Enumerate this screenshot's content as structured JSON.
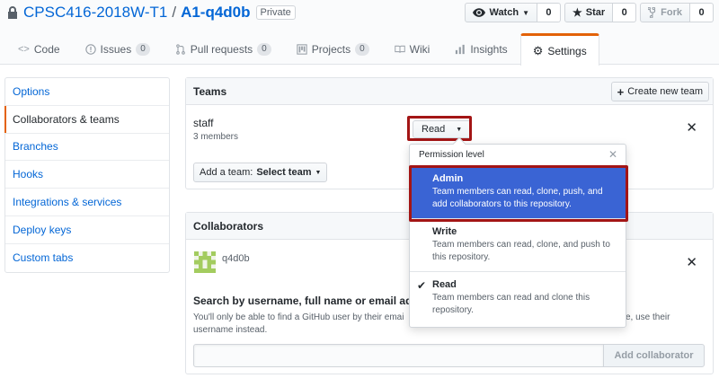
{
  "repo": {
    "owner": "CPSC416-2018W-T1",
    "separator": "/",
    "name": "A1-q4d0b",
    "visibility": "Private"
  },
  "actions": {
    "watch": {
      "label": "Watch",
      "count": "0"
    },
    "star": {
      "label": "Star",
      "count": "0"
    },
    "fork": {
      "label": "Fork",
      "count": "0"
    }
  },
  "tabs": [
    {
      "label": "Code",
      "count": null
    },
    {
      "label": "Issues",
      "count": "0"
    },
    {
      "label": "Pull requests",
      "count": "0"
    },
    {
      "label": "Projects",
      "count": "0"
    },
    {
      "label": "Wiki",
      "count": null
    },
    {
      "label": "Insights",
      "count": null
    },
    {
      "label": "Settings",
      "count": null
    }
  ],
  "sidebar": {
    "items": [
      {
        "label": "Options"
      },
      {
        "label": "Collaborators & teams"
      },
      {
        "label": "Branches"
      },
      {
        "label": "Hooks"
      },
      {
        "label": "Integrations & services"
      },
      {
        "label": "Deploy keys"
      },
      {
        "label": "Custom tabs"
      }
    ],
    "selected_index": 1
  },
  "teams": {
    "header": "Teams",
    "create_button": "Create new team",
    "team": {
      "name": "staff",
      "members": "3 members",
      "permission": "Read"
    },
    "add_team_prefix": "Add a team:",
    "add_team_select": "Select team"
  },
  "permission_dropdown": {
    "header": "Permission level",
    "options": [
      {
        "title": "Admin",
        "description": "Team members can read, clone, push, and add collaborators to this repository.",
        "active": true,
        "checked": false
      },
      {
        "title": "Write",
        "description": "Team members can read, clone, and push to this repository.",
        "active": false,
        "checked": false
      },
      {
        "title": "Read",
        "description": "Team members can read and clone this repository.",
        "active": false,
        "checked": true
      }
    ]
  },
  "collaborators": {
    "header": "Collaborators",
    "user": "q4d0b",
    "search_title": "Search by username, full name or email addr",
    "search_help_left": "You'll only be able to find a GitHub user by their emai",
    "search_help_right": "e, use their",
    "search_help_line2": "username instead.",
    "add_button": "Add collaborator"
  },
  "colors": {
    "accent_orange": "#e36209",
    "link_blue": "#0366d6",
    "active_blue": "#3a64d4",
    "highlight_red": "#a31515"
  }
}
